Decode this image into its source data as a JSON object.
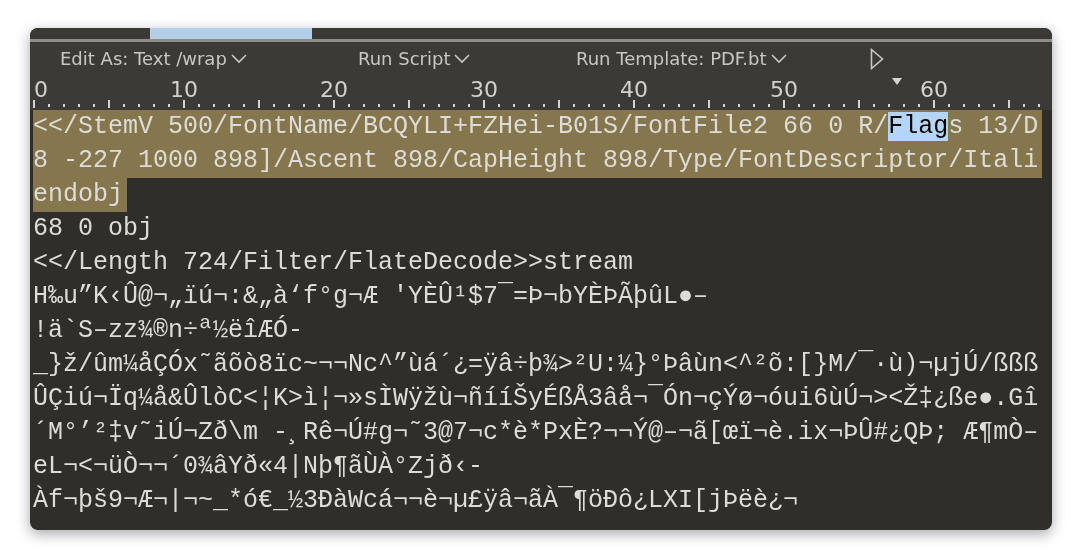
{
  "toolbar": {
    "items": [
      {
        "label": "Edit As: Text /wrap",
        "kind": "dropdown"
      },
      {
        "label": "Run Script",
        "kind": "dropdown"
      },
      {
        "label": "Run Template: PDF.bt",
        "kind": "dropdown"
      },
      {
        "kind": "play"
      }
    ]
  },
  "ruler": {
    "labels": [
      "0",
      "10",
      "20",
      "30",
      "40",
      "50",
      "60"
    ]
  },
  "editor": {
    "lines": [
      {
        "highlighted": true,
        "segments": [
          {
            "text": "<</StemV 500/FontName/BCQYLI+FZHei-B01S/FontFile2 66 0 R/",
            "selected": false
          },
          {
            "text": "Flag",
            "selected": true
          },
          {
            "text": "s 13/D",
            "selected": false
          }
        ]
      },
      {
        "highlighted": true,
        "segments": [
          {
            "text": "8 -227 1000 898]/Ascent 898/CapHeight 898/Type/FontDescriptor/Itali",
            "selected": false
          }
        ]
      },
      {
        "highlighted": true,
        "segments": [
          {
            "text": "endobj",
            "selected": false
          }
        ]
      },
      {
        "highlighted": false,
        "segments": [
          {
            "text": "68 0 obj",
            "selected": false
          }
        ]
      },
      {
        "highlighted": false,
        "segments": [
          {
            "text": "<</Length 724/Filter/FlateDecode>>stream",
            "selected": false
          }
        ]
      },
      {
        "highlighted": false,
        "segments": [
          {
            "text": "H‰u”K‹Û@¬„ïú¬:&„à‘f°g¬Æ 'YÈÛ¹$7¯=Þ¬bYÈÞÃþûL●–",
            "selected": false
          }
        ]
      },
      {
        "highlighted": false,
        "segments": [
          {
            "text": "!ä`S–zz¾®n÷ª½ëîÆÓ-",
            "selected": false
          }
        ]
      },
      {
        "highlighted": false,
        "segments": [
          {
            "text": "_}ž/ûm¼åÇÓx˜ãõò8ïc~¬¬Nc^”ùá´¿=ÿâ÷þ¾>²U:¼}°Þâùn<^²õ:[}M/¯·ù)¬µjÚ/ßßß",
            "selected": false
          }
        ]
      },
      {
        "highlighted": false,
        "segments": [
          {
            "text": "ÛÇiú¬Ïq¼å&ÛlòC<¦K>ì¦¬»sÌWÿžù¬ñííŠyÉßÅ3âå¬¯Ón¬çÝø¬óui6ùÚ¬><Ž‡¿ße●.Gî",
            "selected": false
          }
        ]
      },
      {
        "highlighted": false,
        "segments": [
          {
            "text": "´M°’²‡v˜iÚ¬Zð\\m -¸Rê¬Ú#g¬˜3@7¬c*è*PxÈ?¬¬Ý@–¬ã[œï¬è.ix¬ÞÛ#¿QÞ; Æ¶mÒ–",
            "selected": false
          }
        ]
      },
      {
        "highlighted": false,
        "segments": [
          {
            "text": "eL¬<¬üÒ¬¬´0¾âYð«4|Nþ¶ãÙÀ°Zjð‹-",
            "selected": false
          }
        ]
      },
      {
        "highlighted": false,
        "segments": [
          {
            "text": "Àf¬þš9¬Æ¬|¬~_*ó€_½3ÐàWcá¬¬è¬µ£ÿâ¬ãÀ¯¶öÐô¿LXI[jÞëè¿¬",
            "selected": false
          }
        ]
      }
    ]
  }
}
